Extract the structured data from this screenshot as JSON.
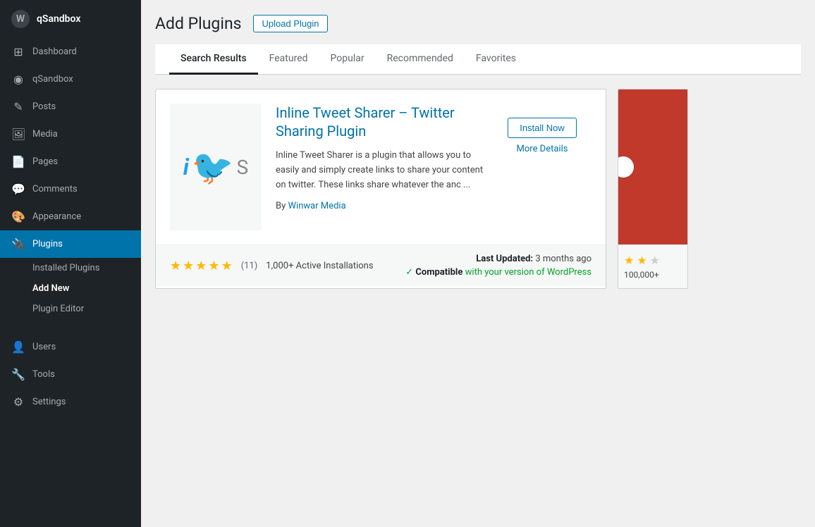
{
  "sidebar": {
    "brand_label": "qSandbox",
    "wp_icon": "W",
    "items": [
      {
        "id": "dashboard",
        "label": "Dashboard",
        "icon": "⊞"
      },
      {
        "id": "qsandbox",
        "label": "qSandbox",
        "icon": "◉"
      },
      {
        "id": "posts",
        "label": "Posts",
        "icon": "✎"
      },
      {
        "id": "media",
        "label": "Media",
        "icon": "🖼"
      },
      {
        "id": "pages",
        "label": "Pages",
        "icon": "📄"
      },
      {
        "id": "comments",
        "label": "Comments",
        "icon": "💬"
      },
      {
        "id": "appearance",
        "label": "Appearance",
        "icon": "🎨"
      },
      {
        "id": "plugins",
        "label": "Plugins",
        "icon": "🔌",
        "active": true
      }
    ],
    "plugins_subitems": [
      {
        "id": "installed-plugins",
        "label": "Installed Plugins"
      },
      {
        "id": "add-new",
        "label": "Add New",
        "active": true
      },
      {
        "id": "plugin-editor",
        "label": "Plugin Editor"
      }
    ],
    "bottom_items": [
      {
        "id": "users",
        "label": "Users",
        "icon": "👤"
      },
      {
        "id": "tools",
        "label": "Tools",
        "icon": "🔧"
      },
      {
        "id": "settings",
        "label": "Settings",
        "icon": "⚙"
      }
    ]
  },
  "page": {
    "title": "Add Plugins",
    "upload_btn": "Upload Plugin"
  },
  "tabs": [
    {
      "id": "search-results",
      "label": "Search Results",
      "active": true
    },
    {
      "id": "featured",
      "label": "Featured"
    },
    {
      "id": "popular",
      "label": "Popular"
    },
    {
      "id": "recommended",
      "label": "Recommended"
    },
    {
      "id": "favorites",
      "label": "Favorites"
    }
  ],
  "plugin_card": {
    "name": "Inline Tweet Sharer – Twitter Sharing Plugin",
    "description": "Inline Tweet Sharer is a plugin that allows you to easily and simply create links to share your content on twitter. These links share whatever the anc ...",
    "author_prefix": "By",
    "author_name": "Winwar Media",
    "install_btn": "Install Now",
    "more_details": "More Details",
    "stars": 5,
    "review_count": "(11)",
    "active_installs": "1,000+ Active Installations",
    "last_updated_label": "Last Updated:",
    "last_updated_value": "3 months ago",
    "compatible_text": "Compatible",
    "compatible_suffix": "with your version of WordPress"
  },
  "partial_card": {
    "stars_partial": "★★☆",
    "installs": "100,000+"
  }
}
